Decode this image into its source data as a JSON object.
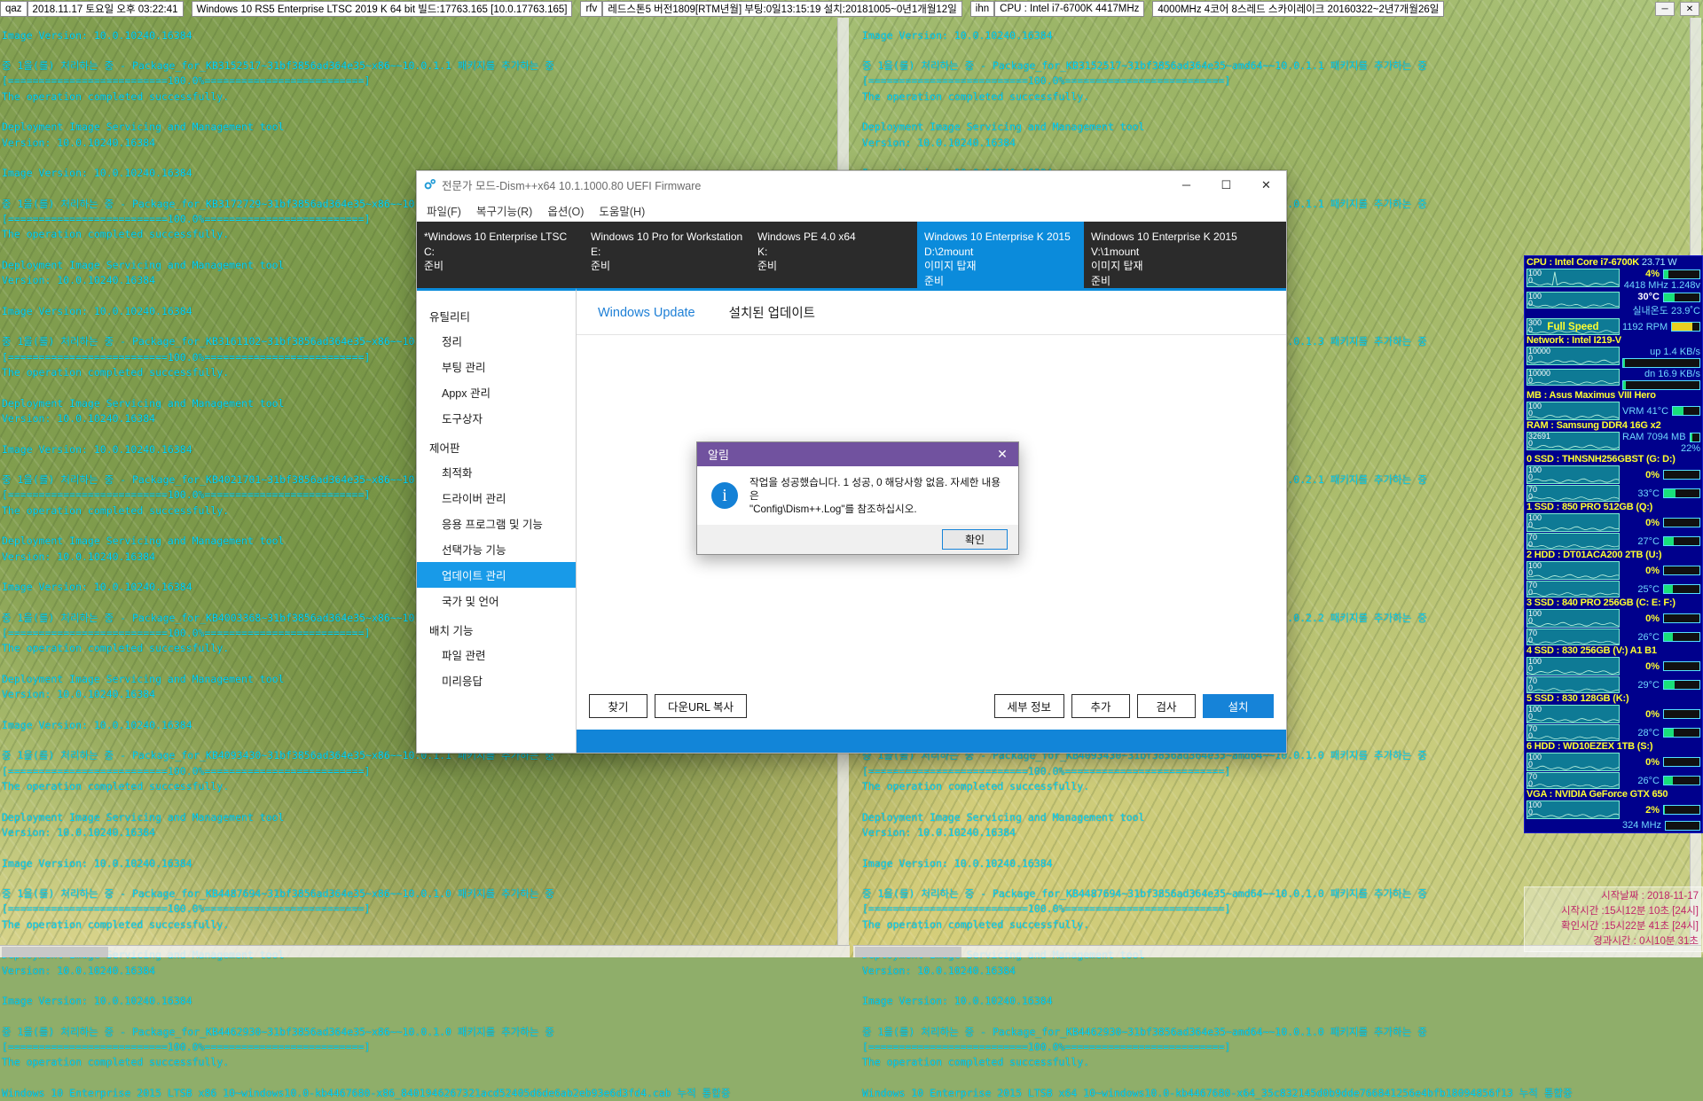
{
  "topbar": {
    "items": [
      "qaz",
      "2018.11.17 토요일 오후 03:22:41",
      "Windows 10 RS5 Enterprise LTSC 2019 K 64 bit 빌드:17763.165 [10.0.17763.165]",
      "rfv",
      "레드스톤5 버전1809[RTM년월] 부팅:0일13:15:19 설치:20181005~0년1개월12일",
      "ihn",
      "CPU : Intel i7-6700K 4417MHz",
      "4000MHz 4코어 8스레드 스카이레이크 20160322~2년7개월26일"
    ],
    "minimize_label": "─",
    "close_label": "✕"
  },
  "console": {
    "left_text": "Image Version: 10.0.10240.16384\n\n중 1을(를) 처리하는 중 - Package_for_KB3152517~31bf3856ad364e35~x86~~10.0.1.1 패키지를 추가하는 중\n[==========================100.0%==========================]\nThe operation completed successfully.\n\nDeployment Image Servicing and Management tool\nVersion: 10.0.10240.16384\n\nImage Version: 10.0.10240.16384\n\n중 1을(를) 처리하는 중 - Package_for_KB3172729~31bf3856ad364e35~x86~~10.0.1.1 패키지를 추가하는 중\n[==========================100.0%==========================]\nThe operation completed successfully.\n\nDeployment Image Servicing and Management tool\nVersion: 10.0.10240.16384\n\nImage Version: 10.0.10240.16384\n\n중 1을(를) 처리하는 중 - Package_for_KB3161102~31bf3856ad364e35~x86~~10.0.1.1 패키지를 추가하는 중\n[==========================100.0%==========================]\nThe operation completed successfully.\n\nDeployment Image Servicing and Management tool\nVersion: 10.0.10240.16384\n\nImage Version: 10.0.10240.16384\n\n중 1을(를) 처리하는 중 - Package_for_KB4021701~31bf3856ad364e35~x86~~10.0.1.1 패키지를 추가하는 중\n[==========================100.0%==========================]\nThe operation completed successfully.\n\nDeployment Image Servicing and Management tool\nVersion: 10.0.10240.16384\n\nImage Version: 10.0.10240.16384\n\n중 1을(를) 처리하는 중 - Package_for_KB4003368~31bf3856ad364e35~x86~~10.0.1.1 패키지를 추가하는 중\n[==========================100.0%==========================]\nThe operation completed successfully.\n\nDeployment Image Servicing and Management tool\nVersion: 10.0.10240.16384\n\nImage Version: 10.0.10240.16384\n\n중 1을(를) 처리하는 중 - Package_for_KB4093430~31bf3856ad364e35~x86~~10.0.1.1 패키지를 추가하는 중\n[==========================100.0%==========================]\nThe operation completed successfully.\n\nDeployment Image Servicing and Management tool\nVersion: 10.0.10240.16384\n\nImage Version: 10.0.10240.16384\n\n중 1을(를) 처리하는 중 - Package_for_KB4487694~31bf3856ad364e35~x86~~10.0.1.0 패키지를 추가하는 중\n[==========================100.0%==========================]\nThe operation completed successfully.\n\nDeployment Image Servicing and Management tool\nVersion: 10.0.10240.16384\n\nImage Version: 10.0.10240.16384\n\n중 1을(를) 처리하는 중 - Package_for_KB4462930~31bf3856ad364e35~x86~~10.0.1.0 패키지를 추가하는 중\n[==========================100.0%==========================]\nThe operation completed successfully.\n\nWindows 10 Enterprise 2015 LTSB x86 10~windows10.0-kb4467680-x86_8401946267321acd52405d6de6ab2eb93e6d3fd4.cab 누적 통합중",
    "right_text": "Image Version: 10.0.10240.16384\n\n중 1을(를) 처리하는 중 - Package_for_KB3152517~31bf3856ad364e35~amd64~~10.0.1.1 패키지를 추가하는 중\n[==========================100.0%==========================]\nThe operation completed successfully.\n\nDeployment Image Servicing and Management tool\nVersion: 10.0.10240.16384\n\nImage Version: 10.0.10240.16384\n\n중 1을(를) 처리하는 중 - Package_for_KB3172729~31bf3856ad364e35~amd64~~10.0.1.1 패키지를 추가하는 중\n[==========================100.0%==========================]\nThe operation completed successfully.\n\nDeployment Image Servicing and Management tool\nVersion: 10.0.10240.16384\n\nImage Version: 10.0.10240.16384\n\n중 1을(를) 처리하는 중 - Package_for_KB3161102~31bf3856ad364e35~amd64~~10.0.1.3 패키지를 추가하는 중\n[==========================100.0%==========================]\nThe operation completed successfully.\n\nDeployment Image Servicing and Management tool\nVersion: 10.0.10240.16384\n\nImage Version: 10.0.10240.16384\n\n중 1을(를) 처리하는 중 - Package_for_KB4021701~31bf3856ad364e35~amd64~~10.0.2.1 패키지를 추가하는 중\n[==========================100.0%==========================]\nThe operation completed successfully.\n\nDeployment Image Servicing and Management tool\nVersion: 10.0.10240.16384\n\nImage Version: 10.0.10240.16384\n\n중 1을(를) 처리하는 중 - Package_for_KB4003368~31bf3856ad364e35~amd64~~10.0.2.2 패키지를 추가하는 중\n[==========================100.0%==========================]\nThe operation completed successfully.\n\nDeployment Image Servicing and Management tool\nVersion: 10.0.10240.16384\n\nImage Version: 10.0.10240.16384\n\n중 1을(를) 처리하는 중 - Package_for_KB4093430~31bf3856ad364e35~amd64~~10.0.1.0 패키지를 추가하는 중\n[==========================100.0%==========================]\nThe operation completed successfully.\n\nDeployment Image Servicing and Management tool\nVersion: 10.0.10240.16384\n\nImage Version: 10.0.10240.16384\n\n중 1을(를) 처리하는 중 - Package_for_KB4487694~31bf3856ad364e35~amd64~~10.0.1.0 패키지를 추가하는 중\n[==========================100.0%==========================]\nThe operation completed successfully.\n\nDeployment Image Servicing and Management tool\nVersion: 10.0.10240.16384\n\nImage Version: 10.0.10240.16384\n\n중 1을(를) 처리하는 중 - Package_for_KB4462930~31bf3856ad364e35~amd64~~10.0.1.0 패키지를 추가하는 중\n[==========================100.0%==========================]\nThe operation completed successfully.\n\nWindows 10 Enterprise 2015 LTSB x64 10~windows10.0-kb4467680-x64_35c832145d0b9dde766841256e4bfb18094856f13 누적 통합중"
  },
  "window": {
    "title": "전문가 모드-Dism++x64 10.1.1000.80 UEFI Firmware",
    "minimize_label": "─",
    "maximize_label": "☐",
    "close_label": "✕",
    "menu": [
      "파일(F)",
      "복구기능(R)",
      "옵션(O)",
      "도움말(H)"
    ]
  },
  "os_tabs": [
    {
      "name": "*Windows 10 Enterprise LTSC",
      "path": "C:",
      "state": "준비",
      "selected": false
    },
    {
      "name": "Windows 10 Pro for Workstation",
      "path": "E:",
      "state": "준비",
      "selected": false
    },
    {
      "name": "Windows PE 4.0 x64",
      "path": "K:",
      "state": "준비",
      "selected": false
    },
    {
      "name": "Windows 10 Enterprise K 2015",
      "path": "D:\\2mount",
      "state": "이미지 탑재",
      "state2": "준비",
      "selected": true
    },
    {
      "name": "Windows 10 Enterprise K 2015",
      "path": "V:\\1mount",
      "state": "이미지 탑재",
      "state2": "준비",
      "selected": false
    }
  ],
  "sidebar": {
    "groups": [
      {
        "label": "유틸리티",
        "items": [
          "정리",
          "부팅 관리",
          "Appx 관리",
          "도구상자"
        ]
      },
      {
        "label": "제어판",
        "items": [
          "최적화",
          "드라이버 관리",
          "응용 프로그램 및 기능",
          "선택가능 기능",
          "업데이트 관리",
          "국가 및 언어"
        ]
      },
      {
        "label": "배치 기능",
        "items": [
          "파일 관련",
          "미리응답"
        ]
      }
    ],
    "active_item": "업데이트 관리"
  },
  "content": {
    "tabs": [
      {
        "label": "Windows Update",
        "selected": true
      },
      {
        "label": "설치된 업데이트",
        "selected": false
      }
    ]
  },
  "buttons": {
    "left": [
      "찾기",
      "다운URL 복사"
    ],
    "right": [
      "세부 정보",
      "추가",
      "검사"
    ],
    "primary": "설치"
  },
  "alert": {
    "title": "알림",
    "close_label": "✕",
    "icon": "info-icon",
    "message_line1": "작업을 성공했습니다. 1 성공, 0 해당사항 없음. 자세한 내용은",
    "message_line2": "\"Config\\Dism++.Log\"를 참조하십시오.",
    "ok_label": "확인"
  },
  "hwmon": {
    "sections": [
      {
        "head": "CPU : Intel Core i7-6700K",
        "head_extra": "23.71 W",
        "rows": [
          {
            "gmax": "100",
            "gmin": "0",
            "val1": "4%",
            "val1_style": "yellow",
            "bar1": 12,
            "val2": "4418 MHz 1.248v"
          },
          {
            "gmax": "100",
            "gmin": "0",
            "val1": "30°C",
            "val1_style": "white",
            "bar1": 30,
            "val2": "실내온도 23.9˚C"
          },
          {
            "gmax": "300",
            "gmin": "0",
            "fullspeed": "Full Speed",
            "val1": "1192 RPM",
            "bar1": 75,
            "bar1_color": "yellow"
          }
        ]
      },
      {
        "head": "Network : Intel I219-V",
        "rows": [
          {
            "gmax": "10000",
            "gmin": "0",
            "val2": "up      1.4 KB/s",
            "bar1": 2
          },
          {
            "gmax": "10000",
            "gmin": "0",
            "val2": "dn     16.9 KB/s",
            "bar1": 4
          }
        ]
      },
      {
        "head": "MB : Asus Maximus VIII Hero",
        "rows": [
          {
            "gmax": "100",
            "gmin": "0",
            "val1": "VRM 41°C",
            "bar1": 41
          }
        ]
      },
      {
        "head": "RAM : Samsung DDR4 16G x2",
        "rows": [
          {
            "gmax": "32691",
            "gmin": "0",
            "val1": "RAM   7094 MB",
            "val2": "22%",
            "bar1": 22
          }
        ]
      },
      {
        "head": "0 SSD : THNSNH256GBST (G: D:)",
        "rows": [
          {
            "gmax": "100",
            "gmin": "0",
            "val1": "0%",
            "val1_style": "yellow",
            "bar1": 0
          },
          {
            "gmax": "70",
            "gmin": "0",
            "val1": "33°C",
            "bar1": 33
          }
        ]
      },
      {
        "head": "1 SSD : 850 PRO 512GB (Q:)",
        "rows": [
          {
            "gmax": "100",
            "gmin": "0",
            "val1": "0%",
            "val1_style": "yellow",
            "bar1": 0
          },
          {
            "gmax": "70",
            "gmin": "0",
            "val1": "27°C",
            "bar1": 27
          }
        ]
      },
      {
        "head": "2 HDD : DT01ACA200 2TB (U:)",
        "rows": [
          {
            "gmax": "100",
            "gmin": "0",
            "val1": "0%",
            "val1_style": "yellow",
            "bar1": 0
          },
          {
            "gmax": "70",
            "gmin": "0",
            "val1": "25°C",
            "bar1": 25
          }
        ]
      },
      {
        "head": "3 SSD : 840 PRO 256GB (C: E: F:)",
        "rows": [
          {
            "gmax": "100",
            "gmin": "0",
            "val1": "0%",
            "val1_style": "yellow",
            "bar1": 0
          },
          {
            "gmax": "70",
            "gmin": "0",
            "val1": "26°C",
            "bar1": 26
          }
        ]
      },
      {
        "head": "4 SSD : 830 256GB (V:) A1 B1",
        "rows": [
          {
            "gmax": "100",
            "gmin": "0",
            "val1": "0%",
            "val1_style": "yellow",
            "bar1": 0
          },
          {
            "gmax": "70",
            "gmin": "0",
            "val1": "29°C",
            "bar1": 29
          }
        ]
      },
      {
        "head": "5 SSD : 830 128GB (K:)",
        "rows": [
          {
            "gmax": "100",
            "gmin": "0",
            "val1": "0%",
            "val1_style": "yellow",
            "bar1": 0
          },
          {
            "gmax": "70",
            "gmin": "0",
            "val1": "28°C",
            "bar1": 28
          }
        ]
      },
      {
        "head": "6 HDD : WD10EZEX 1TB (S:)",
        "rows": [
          {
            "gmax": "100",
            "gmin": "0",
            "val1": "0%",
            "val1_style": "yellow",
            "bar1": 0
          },
          {
            "gmax": "70",
            "gmin": "0",
            "val1": "26°C",
            "bar1": 26
          }
        ]
      },
      {
        "head": "VGA : NVIDIA GeForce GTX 650",
        "rows": [
          {
            "gmax": "100",
            "gmin": "0",
            "val1": "2%",
            "val1_style": "yellow",
            "bar1": 2
          },
          {
            "gmax": "",
            "gmin": "",
            "val1": "324 MHz",
            "bar1": 0,
            "nograph": true
          }
        ]
      }
    ]
  },
  "clock": {
    "lines": [
      "시작날짜 : 2018-11-17",
      "시작시간 :15시12분 10초 [24시]",
      "확인시간 :15시22분 41초 [24시]",
      "경과시간 : 0시10분 31초"
    ]
  }
}
